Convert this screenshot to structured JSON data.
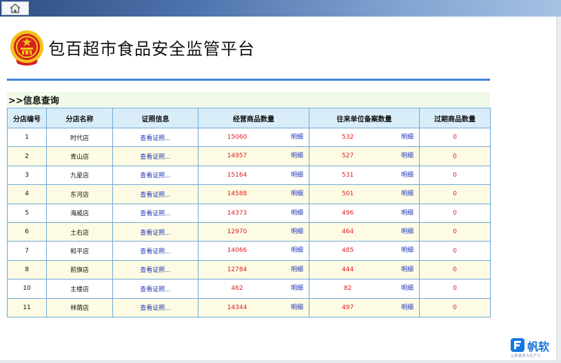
{
  "header": {
    "title": "包百超市食品安全监管平台"
  },
  "section": {
    "title": ">>信息查询"
  },
  "table": {
    "columns": [
      "分店编号",
      "分店名称",
      "证照信息",
      "经营商品数量",
      "往来单位备案数量",
      "过期商品数量"
    ],
    "rows": [
      {
        "id": "1",
        "name": "时代店",
        "cert": "查看证照...",
        "goods": "15060",
        "goods_link": "明细",
        "units": "532",
        "units_link": "明细",
        "expired": "0"
      },
      {
        "id": "2",
        "name": "青山店",
        "cert": "查看证照...",
        "goods": "14957",
        "goods_link": "明细",
        "units": "527",
        "units_link": "明细",
        "expired": "0"
      },
      {
        "id": "3",
        "name": "九星店",
        "cert": "查看证照...",
        "goods": "15164",
        "goods_link": "明细",
        "units": "531",
        "units_link": "明细",
        "expired": "0"
      },
      {
        "id": "4",
        "name": "东河店",
        "cert": "查看证照...",
        "goods": "14588",
        "goods_link": "明细",
        "units": "501",
        "units_link": "明细",
        "expired": "0"
      },
      {
        "id": "5",
        "name": "海威店",
        "cert": "查看证照...",
        "goods": "14373",
        "goods_link": "明细",
        "units": "496",
        "units_link": "明细",
        "expired": "0"
      },
      {
        "id": "6",
        "name": "土右店",
        "cert": "查看证照...",
        "goods": "12970",
        "goods_link": "明细",
        "units": "464",
        "units_link": "明细",
        "expired": "0"
      },
      {
        "id": "7",
        "name": "和平店",
        "cert": "查看证照...",
        "goods": "14066",
        "goods_link": "明细",
        "units": "485",
        "units_link": "明细",
        "expired": "0"
      },
      {
        "id": "8",
        "name": "前旗店",
        "cert": "查看证照...",
        "goods": "12784",
        "goods_link": "明细",
        "units": "444",
        "units_link": "明细",
        "expired": "0"
      },
      {
        "id": "10",
        "name": "主楼店",
        "cert": "查看证照...",
        "goods": "462",
        "goods_link": "明细",
        "units": "82",
        "units_link": "明细",
        "expired": "0"
      },
      {
        "id": "11",
        "name": "林荫店",
        "cert": "查看证照...",
        "goods": "14344",
        "goods_link": "明细",
        "units": "497",
        "units_link": "明细",
        "expired": "0"
      }
    ]
  },
  "brand": {
    "name": "帆软",
    "tagline": "让数据成为生产力"
  },
  "icons": {
    "home": "home-icon",
    "emblem": "national-emblem-icon",
    "brand_logo": "finereport-logo-icon"
  },
  "colors": {
    "accent_rule": "#3f82d8",
    "header_cell": "#d9edf8",
    "alt_row": "#fdfbe3",
    "number_red": "#e11b22",
    "link_blue": "#2038b8"
  }
}
